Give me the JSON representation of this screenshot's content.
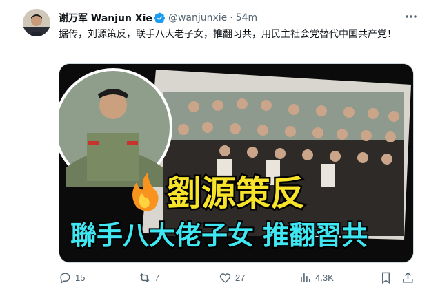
{
  "tweet": {
    "author_name": "谢万军 Wanjun Xie",
    "handle": "@wanjunxie",
    "separator": "·",
    "time": "54m",
    "text": "据传，刘源策反，联手八大老子女，推翻习共，用民主社会党替代中国共产党！"
  },
  "media": {
    "headline": "劉源策反",
    "subline": "聯手八大佬子女 推翻習共",
    "flame_icon": "fire-icon"
  },
  "actions": {
    "replies": "15",
    "retweets": "7",
    "likes": "27",
    "views": "4.3K"
  },
  "colors": {
    "accent": "#1d9bf0",
    "headline_yellow": "#f6e32a",
    "subline_cyan": "#3fe7f2",
    "text_secondary": "#536471"
  }
}
